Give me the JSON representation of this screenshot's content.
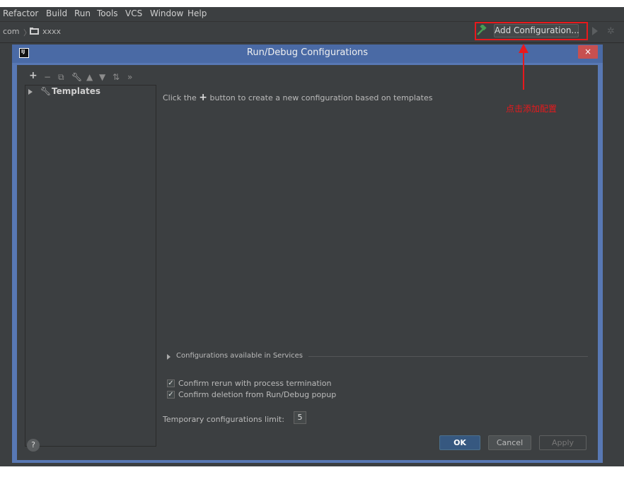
{
  "menubar": {
    "items": [
      "Refactor",
      "Build",
      "Run",
      "Tools",
      "VCS",
      "Window",
      "Help"
    ]
  },
  "navbar": {
    "crumb_prefix": "com",
    "project": "xxxx",
    "add_config_label": "Add Configuration..."
  },
  "annotation": {
    "text": "点击添加配置"
  },
  "dialog": {
    "title": "Run/Debug Configurations",
    "close_label": "×",
    "tree": {
      "templates_label": "Templates"
    },
    "hint_before": "Click the",
    "hint_plus": "+",
    "hint_after": "button to create a new configuration based on templates",
    "services_label": "Configurations available in Services",
    "confirm_rerun": "Confirm rerun with process termination",
    "confirm_deletion": "Confirm deletion from Run/Debug popup",
    "temp_limit_label": "Temporary configurations limit:",
    "temp_limit_value": "5",
    "help_label": "?",
    "ok_label": "OK",
    "cancel_label": "Cancel",
    "apply_label": "Apply"
  },
  "colors": {
    "annotation": "#e8191c",
    "dialog_frame": "#5878b4",
    "ok_button": "#365880"
  }
}
